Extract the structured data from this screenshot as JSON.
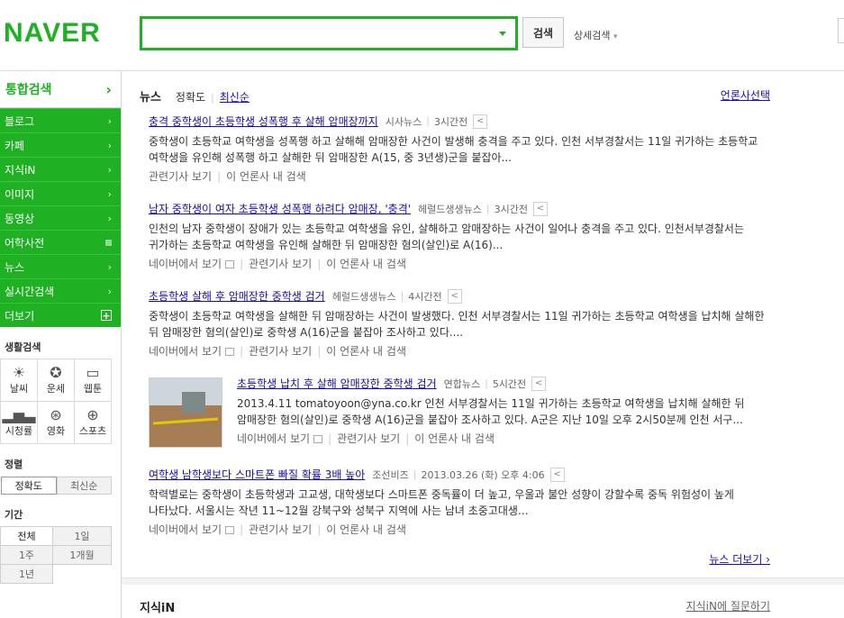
{
  "header": {
    "logo": "NAVER",
    "search_placeholder": "",
    "search_button": "검색",
    "detail_search": "상세검색"
  },
  "sidebar": {
    "head": "통합검색",
    "items": [
      {
        "label": "블로그",
        "marker": "›"
      },
      {
        "label": "카페",
        "marker": "›"
      },
      {
        "label": "지식iN",
        "marker": "›"
      },
      {
        "label": "이미지",
        "marker": "›"
      },
      {
        "label": "동영상",
        "marker": "›"
      },
      {
        "label": "어학사전",
        "marker": "square"
      },
      {
        "label": "뉴스",
        "marker": "›"
      },
      {
        "label": "실시간검색",
        "marker": "›"
      },
      {
        "label": "더보기",
        "marker": "plus"
      }
    ],
    "life_title": "생활검색",
    "life": [
      {
        "label": "날씨",
        "icon": "sun-icon"
      },
      {
        "label": "운세",
        "icon": "star-icon"
      },
      {
        "label": "웹툰",
        "icon": "speech-bubble-icon"
      },
      {
        "label": "시청률",
        "icon": "bar-chart-icon"
      },
      {
        "label": "영화",
        "icon": "film-reel-icon"
      },
      {
        "label": "스포츠",
        "icon": "ball-icon"
      }
    ],
    "sort_title": "정렬",
    "sort": {
      "accuracy": "정확도",
      "latest": "최신순"
    },
    "period_title": "기간",
    "period": [
      "전체",
      "1일",
      "1주",
      "1개월",
      "1년"
    ]
  },
  "news": {
    "title": "뉴스",
    "sort_accuracy": "정확도",
    "sort_latest": "최신순",
    "press_select": "언론사선택",
    "items": [
      {
        "title": "충격 중학생이 초등학생 성폭행 후 살해 암매장까지",
        "source": "시사뉴스",
        "time": "3시간전",
        "body": "중학생이 초등학교 여학생을 성폭행 하고 살해해 암매장한 사건이 발생해 충격을 주고 있다. 인천 서부경찰서는 11일 귀가하는 초등학교 여학생을 유인해 성폭행 하고 살해한 뒤 암매장한 A(15, 중 3년생)군을 붙잡아...",
        "links": [
          "관련기사 보기",
          "이 언론사 내 검색"
        ]
      },
      {
        "title": "남자 중학생이 여자 초등학생 성폭행 하려다 암매장, '충격'",
        "source": "헤럴드생생뉴스",
        "time": "3시간전",
        "body": "인천의 남자 중학생이 장애가 있는 초등학교 여학생을 유인, 살해하고 암매장하는 사건이 일어나 충격을 주고 있다. 인천서부경찰서는 귀가하는 초등학교 여학생을 유인해 살해한 뒤 암매장한 혐의(살인)로 A(16)...",
        "links": [
          "네이버에서 보기",
          "관련기사 보기",
          "이 언론사 내 검색"
        ]
      },
      {
        "title": "초등학생 살해 후 암매장한 중학생 검거",
        "source": "헤럴드생생뉴스",
        "time": "4시간전",
        "body": "중학생이 초등학교 여학생을 살해한 뒤 암매장하는 사건이 발생했다. 인천 서부경찰서는 11일 귀가하는 초등학교 여학생을 납치해 살해한 뒤 암매장한 혐의(살인)로 중학생 A(16)군을 붙잡아 조사하고 있다....",
        "links": [
          "네이버에서 보기",
          "관련기사 보기",
          "이 언론사 내 검색"
        ]
      },
      {
        "title": "초등학생 납치 후 살해 암매장한 중학생 검거",
        "source": "연합뉴스",
        "time": "5시간전",
        "body": "2013.4.11 tomatoyoon@yna.co.kr 인천 서부경찰서는 11일 귀가하는 초등학교 여학생을 납치해 살해한 뒤 암매장한 혐의(살인)로 중학생 A(16)군을 붙잡아 조사하고 있다. A군은 지난 10일 오후 2시50분께 인천 서구...",
        "links": [
          "네이버에서 보기",
          "관련기사 보기",
          "이 언론사 내 검색"
        ]
      },
      {
        "title": "여학생 남학생보다 스마트폰 빠질 확률 3배 높아",
        "source": "조선비즈",
        "time": "2013.03.26 (화) 오후 4:06",
        "body": "학력별로는 중학생이 초등학생과 고교생, 대학생보다 스마트폰 중독률이 더 높고, 우울과 불안 성향이 강할수록 중독 위험성이 높게 나타났다. 서울시는 작년 11~12월 강북구와 성북구 지역에 사는 남녀 초중고대생...",
        "links": [
          "네이버에서 보기",
          "관련기사 보기",
          "이 언론사 내 검색"
        ]
      }
    ],
    "more": "뉴스 더보기"
  },
  "kin": {
    "title": "지식iN",
    "ask": "지식iN에 질문하기"
  },
  "colors": {
    "brand": "#1fb023",
    "link": "#1a0dab"
  }
}
